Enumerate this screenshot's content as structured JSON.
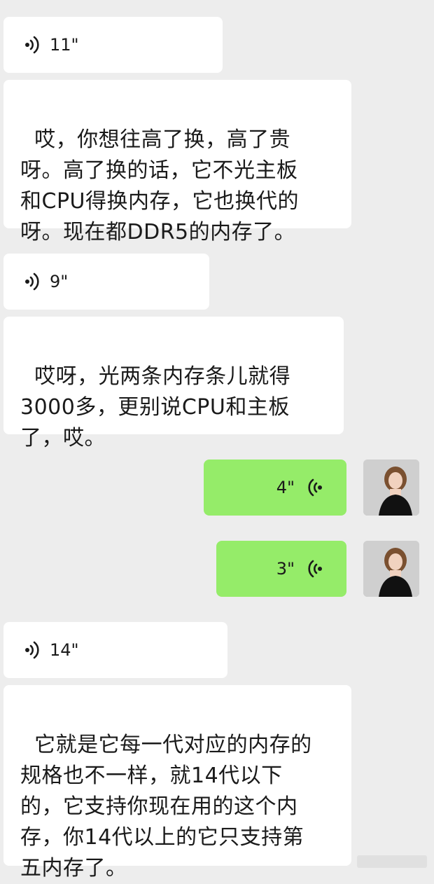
{
  "messages": [
    {
      "type": "voice",
      "side": "left",
      "duration": "11\""
    },
    {
      "type": "text",
      "side": "left",
      "text": "哎，你想往高了换，高了贵\n呀。高了换的话，它不光主板\n和CPU得换内存，它也换代的\n呀。现在都DDR5的内存了。"
    },
    {
      "type": "voice",
      "side": "left",
      "duration": "9\""
    },
    {
      "type": "text",
      "side": "left",
      "text": "哎呀，光两条内存条儿就得\n3000多，更别说CPU和主板\n了，哎。"
    },
    {
      "type": "voice",
      "side": "right",
      "duration": "4\""
    },
    {
      "type": "voice",
      "side": "right",
      "duration": "3\""
    },
    {
      "type": "voice",
      "side": "left",
      "duration": "14\""
    },
    {
      "type": "text",
      "side": "left",
      "text": "它就是它每一代对应的内存的\n规格也不一样，就14代以下\n的，它支持你现在用的这个内\n存，你14代以上的它只支持第\n五内存了。"
    }
  ],
  "colors": {
    "background": "#ededed",
    "incoming": "#ffffff",
    "outgoing": "#95ec69"
  },
  "icons": {
    "voice": "voice-wave-icon",
    "avatar": "user-avatar"
  }
}
